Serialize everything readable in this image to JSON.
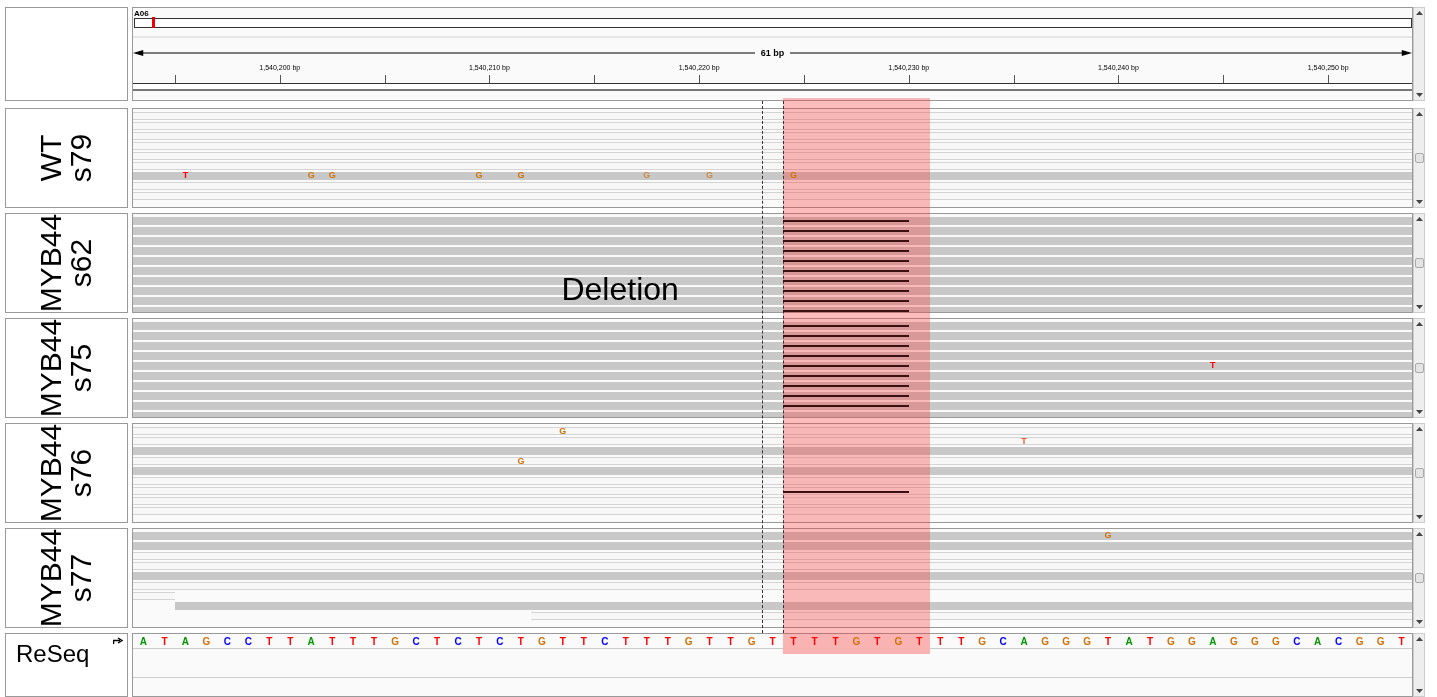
{
  "header": {
    "chromosome": "A06",
    "span": "61 bp",
    "ticks": [
      "1,540,200 bp",
      "1,540,210 bp",
      "1,540,220 bp",
      "1,540,230 bp",
      "1,540,240 bp",
      "1,540,250 bp"
    ]
  },
  "tracks": [
    {
      "label": "WT",
      "sample": "s79",
      "reads": [
        {
          "kind": "light"
        },
        {
          "kind": "light"
        },
        {
          "kind": "light"
        },
        {
          "kind": "light"
        },
        {
          "kind": "light"
        },
        {
          "kind": "light"
        },
        {
          "kind": "dark",
          "mismatches": [
            {
              "base": "T",
              "color": "#ff0000"
            },
            {
              "base": "G",
              "color": "#d17105"
            },
            {
              "base": "G",
              "color": "#d17105"
            },
            {
              "base": "G",
              "color": "#d17105"
            },
            {
              "base": "G",
              "color": "#d17105"
            },
            {
              "base": "G",
              "color": "#c98a44"
            },
            {
              "base": "G",
              "color": "#c98a44"
            },
            {
              "base": "G",
              "color": "#d17105"
            }
          ]
        },
        {
          "kind": "light"
        },
        {
          "kind": "light"
        }
      ]
    },
    {
      "label": "MYB44",
      "sample": "s62",
      "note": "Deletion",
      "reads": [
        {
          "kind": "dark",
          "deletion": true
        },
        {
          "kind": "dark",
          "deletion": true
        },
        {
          "kind": "dark",
          "deletion": true
        },
        {
          "kind": "dark",
          "deletion": true
        },
        {
          "kind": "dark",
          "deletion": true
        },
        {
          "kind": "dark",
          "deletion": true
        },
        {
          "kind": "dark",
          "deletion": true
        },
        {
          "kind": "dark",
          "deletion": true
        },
        {
          "kind": "dark",
          "deletion": true
        },
        {
          "kind": "dark",
          "deletion": true
        }
      ]
    },
    {
      "label": "MYB44",
      "sample": "s75",
      "reads": [
        {
          "kind": "dark",
          "deletion": true
        },
        {
          "kind": "dark",
          "deletion": true
        },
        {
          "kind": "dark",
          "deletion": true
        },
        {
          "kind": "dark",
          "deletion": true
        },
        {
          "kind": "dark",
          "deletion": true,
          "mismatches": [
            {
              "base": "T",
              "color": "#ff0000"
            }
          ]
        },
        {
          "kind": "dark",
          "deletion": true
        },
        {
          "kind": "dark",
          "deletion": true
        },
        {
          "kind": "dark",
          "deletion": true
        },
        {
          "kind": "dark",
          "deletion": true
        },
        {
          "kind": "dark"
        }
      ]
    },
    {
      "label": "MYB44",
      "sample": "s76",
      "reads": [
        {
          "kind": "light",
          "mismatches": [
            {
              "base": "G",
              "color": "#d17105"
            }
          ]
        },
        {
          "kind": "light",
          "mismatches": [
            {
              "base": "T",
              "color": "#f06040"
            }
          ]
        },
        {
          "kind": "dark"
        },
        {
          "kind": "light",
          "mismatches": [
            {
              "base": "G",
              "color": "#d17105"
            }
          ]
        },
        {
          "kind": "dark"
        },
        {
          "kind": "light"
        },
        {
          "kind": "light",
          "deletion": true
        },
        {
          "kind": "light"
        },
        {
          "kind": "light"
        }
      ]
    },
    {
      "label": "MYB44",
      "sample": "s77",
      "reads": [
        {
          "kind": "dark",
          "mismatches": [
            {
              "base": "G",
              "color": "#d17105"
            }
          ]
        },
        {
          "kind": "dark"
        },
        {
          "kind": "light"
        },
        {
          "kind": "light"
        },
        {
          "kind": "dark"
        },
        {
          "kind": "light"
        },
        {
          "kind": "light"
        },
        {
          "kind": "dark"
        },
        {
          "kind": "light"
        }
      ]
    }
  ],
  "reference": {
    "label": "ReSeq",
    "bases": [
      {
        "base": "A",
        "color": "#009600",
        "highlighted": false
      },
      {
        "base": "T",
        "color": "#ff0000",
        "highlighted": false
      },
      {
        "base": "A",
        "color": "#009600",
        "highlighted": false
      },
      {
        "base": "G",
        "color": "#d17105",
        "highlighted": false
      },
      {
        "base": "C",
        "color": "#0000ff",
        "highlighted": false
      },
      {
        "base": "C",
        "color": "#0000ff",
        "highlighted": false
      },
      {
        "base": "T",
        "color": "#ff0000",
        "highlighted": false
      },
      {
        "base": "T",
        "color": "#ff0000",
        "highlighted": false
      },
      {
        "base": "A",
        "color": "#009600",
        "highlighted": false
      },
      {
        "base": "T",
        "color": "#ff0000",
        "highlighted": false
      },
      {
        "base": "T",
        "color": "#ff0000",
        "highlighted": false
      },
      {
        "base": "T",
        "color": "#ff0000",
        "highlighted": false
      },
      {
        "base": "G",
        "color": "#d17105",
        "highlighted": false
      },
      {
        "base": "C",
        "color": "#0000ff",
        "highlighted": false
      },
      {
        "base": "T",
        "color": "#ff0000",
        "highlighted": false
      },
      {
        "base": "C",
        "color": "#0000ff",
        "highlighted": false
      },
      {
        "base": "T",
        "color": "#ff0000",
        "highlighted": false
      },
      {
        "base": "C",
        "color": "#0000ff",
        "highlighted": false
      },
      {
        "base": "T",
        "color": "#ff0000",
        "highlighted": false
      },
      {
        "base": "G",
        "color": "#d17105",
        "highlighted": false
      },
      {
        "base": "T",
        "color": "#ff0000",
        "highlighted": false
      },
      {
        "base": "T",
        "color": "#ff0000",
        "highlighted": false
      },
      {
        "base": "C",
        "color": "#0000ff",
        "highlighted": false
      },
      {
        "base": "T",
        "color": "#ff0000",
        "highlighted": false
      },
      {
        "base": "T",
        "color": "#ff0000",
        "highlighted": false
      },
      {
        "base": "T",
        "color": "#ff0000",
        "highlighted": false
      },
      {
        "base": "G",
        "color": "#d17105",
        "highlighted": false
      },
      {
        "base": "T",
        "color": "#ff0000",
        "highlighted": false
      },
      {
        "base": "T",
        "color": "#ff0000",
        "highlighted": false
      },
      {
        "base": "G",
        "color": "#d17105",
        "highlighted": false
      },
      {
        "base": "T",
        "color": "#ff0000",
        "highlighted": false
      },
      {
        "base": "T",
        "color": "#ff0000",
        "highlighted": true
      },
      {
        "base": "T",
        "color": "#ff0000",
        "highlighted": true
      },
      {
        "base": "T",
        "color": "#ff0000",
        "highlighted": true
      },
      {
        "base": "G",
        "color": "#d17105",
        "highlighted": true
      },
      {
        "base": "T",
        "color": "#ff0000",
        "highlighted": true
      },
      {
        "base": "G",
        "color": "#d17105",
        "highlighted": true
      },
      {
        "base": "T",
        "color": "#ff0000",
        "highlighted": true
      },
      {
        "base": "T",
        "color": "#ff0000",
        "highlighted": false
      },
      {
        "base": "T",
        "color": "#ff0000",
        "highlighted": false
      },
      {
        "base": "G",
        "color": "#d17105",
        "highlighted": false
      },
      {
        "base": "C",
        "color": "#0000ff",
        "highlighted": false
      },
      {
        "base": "A",
        "color": "#009600",
        "highlighted": false
      },
      {
        "base": "G",
        "color": "#d17105",
        "highlighted": false
      },
      {
        "base": "G",
        "color": "#d17105",
        "highlighted": false
      },
      {
        "base": "G",
        "color": "#d17105",
        "highlighted": false
      },
      {
        "base": "T",
        "color": "#ff0000",
        "highlighted": false
      },
      {
        "base": "A",
        "color": "#009600",
        "highlighted": false
      },
      {
        "base": "T",
        "color": "#ff0000",
        "highlighted": false
      },
      {
        "base": "G",
        "color": "#d17105",
        "highlighted": false
      },
      {
        "base": "G",
        "color": "#d17105",
        "highlighted": false
      },
      {
        "base": "A",
        "color": "#009600",
        "highlighted": false
      },
      {
        "base": "G",
        "color": "#d17105",
        "highlighted": false
      },
      {
        "base": "G",
        "color": "#d17105",
        "highlighted": false
      },
      {
        "base": "G",
        "color": "#d17105",
        "highlighted": false
      },
      {
        "base": "C",
        "color": "#0000ff",
        "highlighted": false
      },
      {
        "base": "A",
        "color": "#009600",
        "highlighted": false
      },
      {
        "base": "C",
        "color": "#0000ff",
        "highlighted": false
      },
      {
        "base": "G",
        "color": "#d17105",
        "highlighted": false
      },
      {
        "base": "G",
        "color": "#d17105",
        "highlighted": false
      },
      {
        "base": "T",
        "color": "#ff0000",
        "highlighted": false
      }
    ]
  },
  "center_line": true
}
